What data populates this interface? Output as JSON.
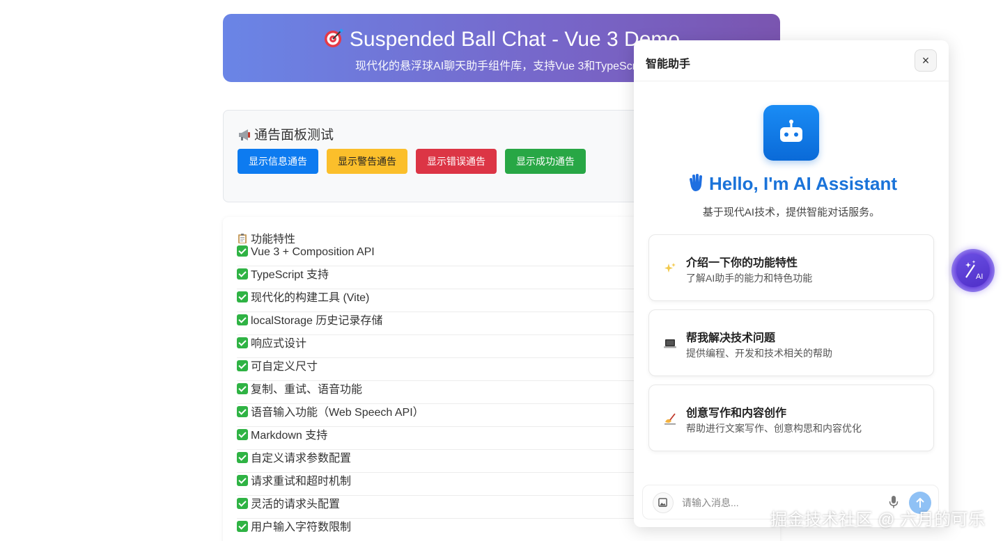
{
  "banner": {
    "title": "Suspended Ball Chat - Vue 3 Demo",
    "subtitle": "现代化的悬浮球AI聊天助手组件库，支持Vue 3和TypeScript"
  },
  "notice": {
    "title": "通告面板测试",
    "buttons": {
      "info": "显示信息通告",
      "warning": "显示警告通告",
      "error": "显示错误通告",
      "success": "显示成功通告"
    }
  },
  "features": {
    "title": "功能特性",
    "items": [
      "Vue 3 + Composition API",
      "TypeScript 支持",
      "现代化的构建工具 (Vite)",
      "localStorage 历史记录存储",
      "响应式设计",
      "可自定义尺寸",
      "复制、重试、语音功能",
      "语音输入功能（Web Speech API）",
      "Markdown 支持",
      "自定义请求参数配置",
      "请求重试和超时机制",
      "灵活的请求头配置",
      "用户输入字符数限制"
    ]
  },
  "chat": {
    "title": "智能助手",
    "close_label": "×",
    "hello": "Hello, I'm AI Assistant",
    "description": "基于现代AI技术，提供智能对话服务。",
    "cards": [
      {
        "icon": "sparkles-icon",
        "title": "介绍一下你的功能特性",
        "subtitle": "了解AI助手的能力和特色功能"
      },
      {
        "icon": "laptop-icon",
        "title": "帮我解决技术问题",
        "subtitle": "提供编程、开发和技术相关的帮助"
      },
      {
        "icon": "writing-hand-icon",
        "title": "创意写作和内容创作",
        "subtitle": "帮助进行文案写作、创意构思和内容优化"
      }
    ],
    "input_placeholder": "请输入消息..."
  },
  "floating_ball": {
    "label": "AI"
  },
  "watermark": "掘金技术社区 @ 六月的可乐",
  "colors": {
    "accent": "#1a73d9",
    "info": "#0d7bf0",
    "warning": "#fbbf2b",
    "error": "#dc3545",
    "success": "#28a745",
    "ball": "#5b3fd6"
  }
}
